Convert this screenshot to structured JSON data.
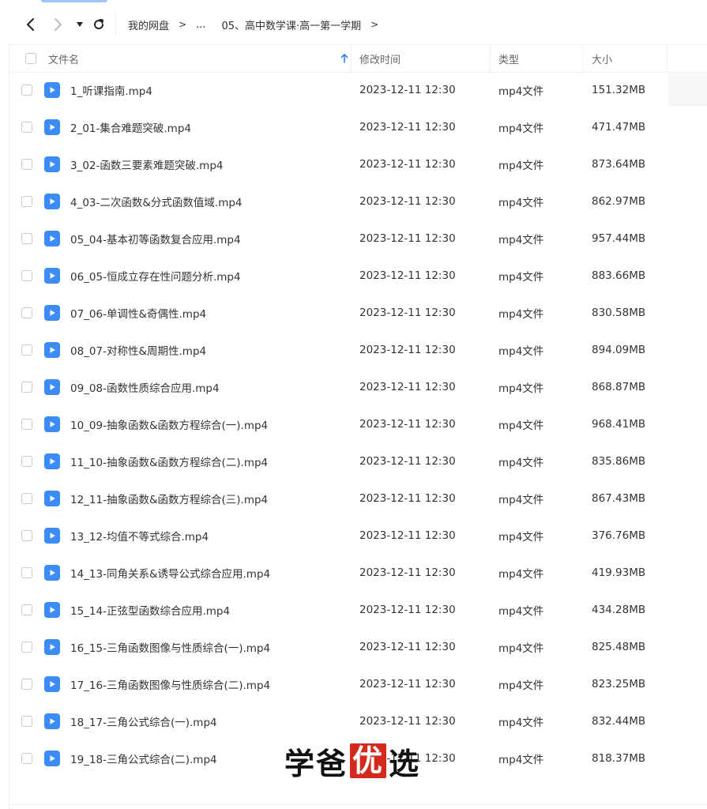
{
  "breadcrumb": {
    "items": [
      "我的网盘",
      "...",
      "05、高中数学课·高一第一学期"
    ]
  },
  "columns": {
    "name": "文件名",
    "modified": "修改时间",
    "type": "类型",
    "size": "大小"
  },
  "colors": {
    "accent": "#3d8cf6",
    "sort_arrow": "#2f80ed",
    "stamp": "#d42a1e"
  },
  "files": [
    {
      "name": "1_听课指南.mp4",
      "modified": "2023-12-11 12:30",
      "type": "mp4文件",
      "size": "151.32MB"
    },
    {
      "name": "2_01-集合难题突破.mp4",
      "modified": "2023-12-11 12:30",
      "type": "mp4文件",
      "size": "471.47MB"
    },
    {
      "name": "3_02-函数三要素难题突破.mp4",
      "modified": "2023-12-11 12:30",
      "type": "mp4文件",
      "size": "873.64MB"
    },
    {
      "name": "4_03-二次函数&分式函数值域.mp4",
      "modified": "2023-12-11 12:30",
      "type": "mp4文件",
      "size": "862.97MB"
    },
    {
      "name": "05_04-基本初等函数复合应用.mp4",
      "modified": "2023-12-11 12:30",
      "type": "mp4文件",
      "size": "957.44MB"
    },
    {
      "name": "06_05-恒成立存在性问题分析.mp4",
      "modified": "2023-12-11 12:30",
      "type": "mp4文件",
      "size": "883.66MB"
    },
    {
      "name": "07_06-单调性&奇偶性.mp4",
      "modified": "2023-12-11 12:30",
      "type": "mp4文件",
      "size": "830.58MB"
    },
    {
      "name": "08_07-对称性&周期性.mp4",
      "modified": "2023-12-11 12:30",
      "type": "mp4文件",
      "size": "894.09MB"
    },
    {
      "name": "09_08-函数性质综合应用.mp4",
      "modified": "2023-12-11 12:30",
      "type": "mp4文件",
      "size": "868.87MB"
    },
    {
      "name": "10_09-抽象函数&函数方程综合(一).mp4",
      "modified": "2023-12-11 12:30",
      "type": "mp4文件",
      "size": "968.41MB"
    },
    {
      "name": "11_10-抽象函数&函数方程综合(二).mp4",
      "modified": "2023-12-11 12:30",
      "type": "mp4文件",
      "size": "835.86MB"
    },
    {
      "name": "12_11-抽象函数&函数方程综合(三).mp4",
      "modified": "2023-12-11 12:30",
      "type": "mp4文件",
      "size": "867.43MB"
    },
    {
      "name": "13_12-均值不等式综合.mp4",
      "modified": "2023-12-11 12:30",
      "type": "mp4文件",
      "size": "376.76MB"
    },
    {
      "name": "14_13-同角关系&诱导公式综合应用.mp4",
      "modified": "2023-12-11 12:30",
      "type": "mp4文件",
      "size": "419.93MB"
    },
    {
      "name": "15_14-正弦型函数综合应用.mp4",
      "modified": "2023-12-11 12:30",
      "type": "mp4文件",
      "size": "434.28MB"
    },
    {
      "name": "16_15-三角函数图像与性质综合(一).mp4",
      "modified": "2023-12-11 12:30",
      "type": "mp4文件",
      "size": "825.48MB"
    },
    {
      "name": "17_16-三角函数图像与性质综合(二).mp4",
      "modified": "2023-12-11 12:30",
      "type": "mp4文件",
      "size": "823.25MB"
    },
    {
      "name": "18_17-三角公式综合(一).mp4",
      "modified": "2023-12-11 12:30",
      "type": "mp4文件",
      "size": "832.44MB"
    },
    {
      "name": "19_18-三角公式综合(二).mp4",
      "modified": "2023-12-11 12:30",
      "type": "mp4文件",
      "size": "818.37MB"
    }
  ],
  "watermark": {
    "before": "学爸",
    "stamp": "优",
    "after": "选"
  }
}
